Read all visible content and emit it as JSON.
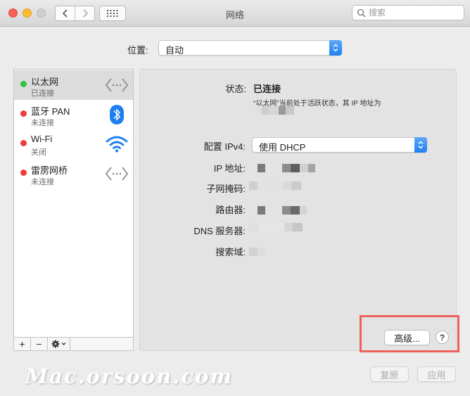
{
  "window": {
    "title": "网络",
    "search_placeholder": "搜索"
  },
  "location": {
    "label": "位置:",
    "value": "自动"
  },
  "services": [
    {
      "name": "以太网",
      "status": "已连接",
      "color": "#2fc443",
      "icon": "ethernet-icon"
    },
    {
      "name": "蓝牙 PAN",
      "status": "未连接",
      "color": "#ee3b3b",
      "icon": "bluetooth-icon"
    },
    {
      "name": "Wi-Fi",
      "status": "关闭",
      "color": "#ee3b3b",
      "icon": "wifi-icon"
    },
    {
      "name": "雷雳网桥",
      "status": "未连接",
      "color": "#ee3b3b",
      "icon": "ethernet-icon"
    }
  ],
  "sidebar_toolbar": {
    "add": "+",
    "remove": "−"
  },
  "detail": {
    "status_label": "状态:",
    "status_value": "已连接",
    "status_description": "“以太网”当前处于活跃状态，其 IP 地址为",
    "configure_label": "配置 IPv4:",
    "configure_value": "使用 DHCP",
    "ip_label": "IP 地址:",
    "subnet_label": "子网掩码:",
    "router_label": "路由器:",
    "dns_label": "DNS 服务器:",
    "search_domain_label": "搜索域:",
    "advanced_button": "高级...",
    "help_button": "?"
  },
  "footer": {
    "revert_button": "复原",
    "apply_button": "应用"
  },
  "watermark": "Mac.orsoon.com",
  "colors": {
    "accent": "#1f7ff0",
    "connected": "#2fc443",
    "disconnected": "#ee3b3b",
    "highlight": "#ec6259"
  }
}
